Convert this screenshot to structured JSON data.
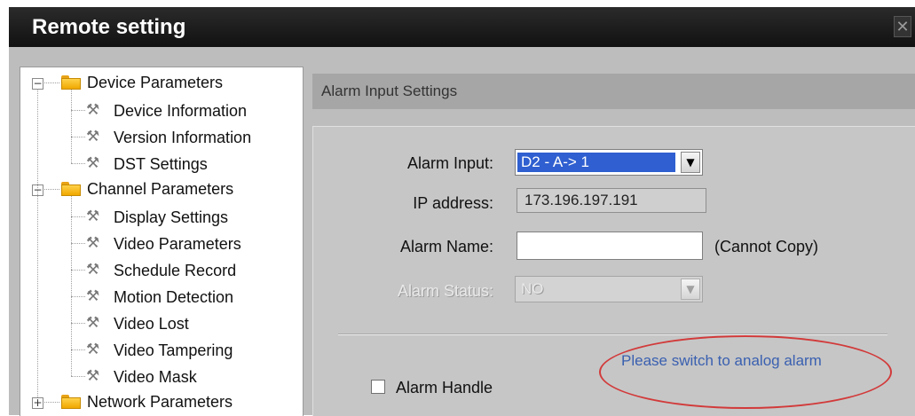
{
  "window": {
    "title": "Remote setting",
    "close_glyph": "✕"
  },
  "tree": [
    {
      "type": "group",
      "label": "Device Parameters",
      "expander": "−",
      "icon": "folder-icon"
    },
    {
      "type": "item",
      "label": "Device Information",
      "icon": "wrench-icon"
    },
    {
      "type": "item",
      "label": "Version Information",
      "icon": "wrench-icon"
    },
    {
      "type": "item",
      "label": "DST Settings",
      "icon": "wrench-icon"
    },
    {
      "type": "group",
      "label": "Channel Parameters",
      "expander": "−",
      "icon": "folder-icon"
    },
    {
      "type": "item",
      "label": "Display Settings",
      "icon": "wrench-icon"
    },
    {
      "type": "item",
      "label": "Video Parameters",
      "icon": "wrench-icon"
    },
    {
      "type": "item",
      "label": "Schedule Record",
      "icon": "wrench-icon"
    },
    {
      "type": "item",
      "label": "Motion Detection",
      "icon": "wrench-icon"
    },
    {
      "type": "item",
      "label": "Video Lost",
      "icon": "wrench-icon"
    },
    {
      "type": "item",
      "label": "Video Tampering",
      "icon": "wrench-icon"
    },
    {
      "type": "item",
      "label": "Video Mask",
      "icon": "wrench-icon"
    },
    {
      "type": "group",
      "label": "Network Parameters",
      "expander": "+",
      "icon": "folder-icon"
    }
  ],
  "panel": {
    "header": "Alarm Input Settings",
    "alarm_input": {
      "label": "Alarm Input:",
      "value": "D2 - A-> 1",
      "arrow": "▼"
    },
    "ip_address": {
      "label": "IP address:",
      "value": "173.196.197.191"
    },
    "alarm_name": {
      "label": "Alarm Name:",
      "value": "",
      "note": "(Cannot Copy)"
    },
    "alarm_status": {
      "label": "Alarm Status:",
      "value": "NO",
      "arrow": "▼"
    },
    "switch_link": "Please switch to analog alarm",
    "alarm_handle": {
      "label": "Alarm Handle",
      "checked": false
    }
  },
  "colors": {
    "titlebar": "#1a1a1a",
    "selection": "#2f5fd0",
    "annotation": "#d23a3a",
    "link": "#3a60b0"
  }
}
